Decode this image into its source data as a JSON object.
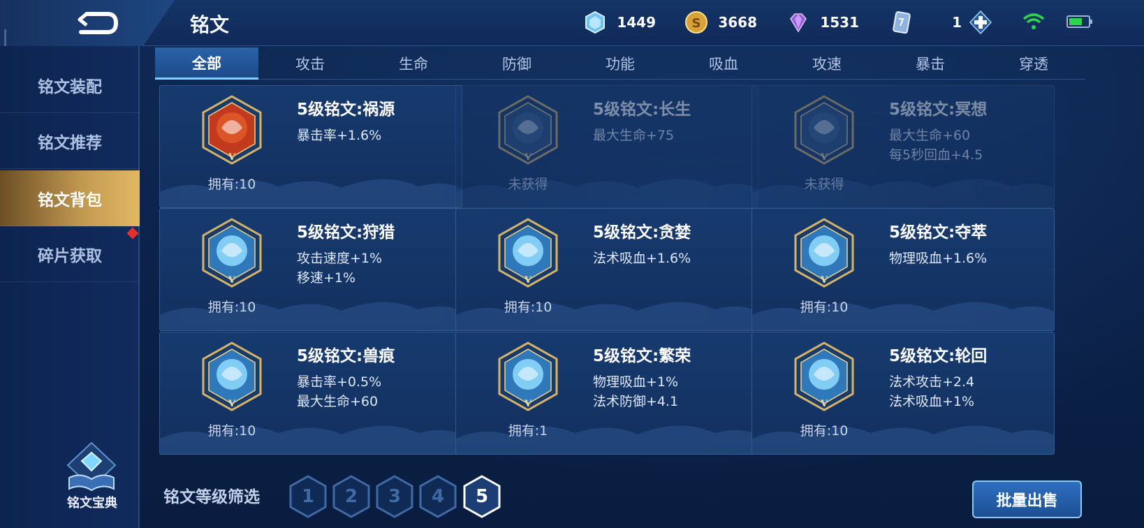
{
  "header": {
    "title": "铭文",
    "currencies": [
      {
        "icon": "diamond-icon",
        "value": "1449"
      },
      {
        "icon": "gold-coin-icon",
        "value": "3668"
      },
      {
        "icon": "gem-icon",
        "value": "1531"
      },
      {
        "icon": "card-ticket-icon",
        "value": "1"
      }
    ]
  },
  "sidebar": {
    "items": [
      {
        "label": "铭文装配"
      },
      {
        "label": "铭文推荐"
      },
      {
        "label": "铭文背包",
        "active": true
      },
      {
        "label": "碎片获取"
      }
    ],
    "codex_label": "铭文宝典"
  },
  "tabs": [
    "全部",
    "攻击",
    "生命",
    "防御",
    "功能",
    "吸血",
    "攻速",
    "暴击",
    "穿透"
  ],
  "active_tab": "全部",
  "cards": [
    {
      "name": "5级铭文:祸源",
      "stats": [
        "暴击率+1.6%"
      ],
      "owned": "拥有:10",
      "color": "#c23a1e"
    },
    {
      "name": "5级铭文:长生",
      "stats": [
        "最大生命+75"
      ],
      "owned": "未获得",
      "color": "#3b6fa8"
    },
    {
      "name": "5级铭文:冥想",
      "stats": [
        "最大生命+60",
        "每5秒回血+4.5"
      ],
      "owned": "未获得",
      "color": "#3b6fa8"
    },
    {
      "name": "5级铭文:狩猎",
      "stats": [
        "攻击速度+1%",
        "移速+1%"
      ],
      "owned": "拥有:10",
      "color": "#3b8fd0"
    },
    {
      "name": "5级铭文:贪婪",
      "stats": [
        "法术吸血+1.6%"
      ],
      "owned": "拥有:10",
      "color": "#3b8fd0"
    },
    {
      "name": "5级铭文:夺萃",
      "stats": [
        "物理吸血+1.6%"
      ],
      "owned": "拥有:10",
      "color": "#3b8fd0"
    },
    {
      "name": "5级铭文:兽痕",
      "stats": [
        "暴击率+0.5%",
        "最大生命+60"
      ],
      "owned": "拥有:10",
      "color": "#3b8fd0"
    },
    {
      "name": "5级铭文:繁荣",
      "stats": [
        "物理吸血+1%",
        "法术防御+4.1"
      ],
      "owned": "拥有:1",
      "color": "#3b8fd0"
    },
    {
      "name": "5级铭文:轮回",
      "stats": [
        "法术攻击+2.4",
        "法术吸血+1%"
      ],
      "owned": "拥有:10",
      "color": "#3b8fd0"
    }
  ],
  "emblem_level_mark": "V",
  "filter": {
    "label": "铭文等级筛选",
    "levels": [
      "1",
      "2",
      "3",
      "4",
      "5"
    ],
    "active": "5"
  },
  "sell_button": "批量出售"
}
